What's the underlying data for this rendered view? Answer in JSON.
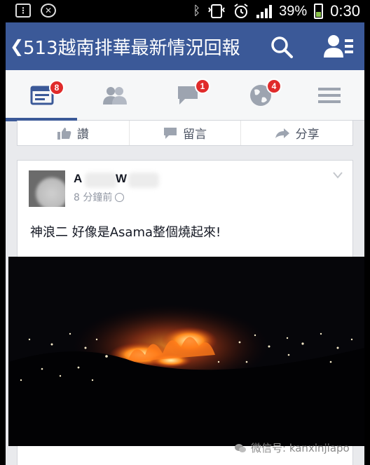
{
  "status_bar": {
    "left_icons": [
      "message-icon",
      "no-sim-icon"
    ],
    "right_icons": [
      "bluetooth-icon",
      "vibrate-icon",
      "alarm-icon",
      "signal-icon",
      "battery-icon"
    ],
    "battery_percent": "39%",
    "battery_level": 0.39,
    "time": "0:30",
    "accent": "#8bc34a"
  },
  "title_bar": {
    "title": "513越南排華最新情況回報",
    "background": "#3b5998"
  },
  "tabs": [
    {
      "name": "news-feed",
      "icon": "newsfeed-icon",
      "badge": "8",
      "active": true
    },
    {
      "name": "friends",
      "icon": "friends-icon",
      "badge": null,
      "active": false
    },
    {
      "name": "messages",
      "icon": "messages-icon",
      "badge": "1",
      "active": false
    },
    {
      "name": "notifications",
      "icon": "globe-icon",
      "badge": "4",
      "active": false
    },
    {
      "name": "more",
      "icon": "menu-icon",
      "badge": null,
      "active": false
    }
  ],
  "previous_post_actions": {
    "like": "讚",
    "comment": "留言",
    "share": "分享"
  },
  "post": {
    "author_first": "A",
    "author_second": "W",
    "time": "8 分鐘前",
    "text": "神浪二 好像是Asama整個燒起來!"
  },
  "watermark": {
    "text": "微信号: kanxinjiapo"
  }
}
